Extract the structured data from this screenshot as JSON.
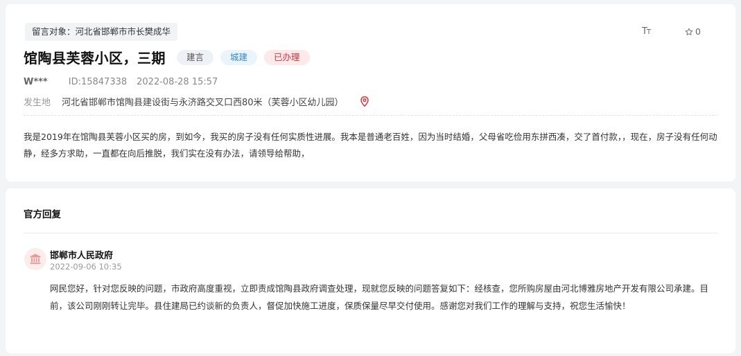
{
  "message": {
    "target_label": "留言对象：河北省邯郸市市长樊成华",
    "title": "馆陶县芙蓉小区，三期",
    "tags": {
      "type": "建言",
      "category": "城建",
      "status": "已办理"
    },
    "tools": {
      "font_size_icon_big": "T",
      "font_size_icon_small": "T",
      "favorite_count": "0"
    },
    "author": "W***",
    "id_text": "ID:15847338",
    "time": "2022-08-28 15:57",
    "location_label": "发生地",
    "location": "河北省邯郸市馆陶县建设街与永济路交叉口西80米（芙蓉小区幼儿园）",
    "content": "我是2019年在馆陶县芙蓉小区买的房，到如今，我买的房子没有任何实质性进展。我本是普通老百姓，因为当时结婚，父母省吃俭用东拼西凑，交了首付款，，现在，房子没有任何动静，经多方求助，一直都在向后推脱，我们实在没有办法，请领导给帮助，"
  },
  "reply": {
    "heading": "官方回复",
    "org_name": "邯郸市人民政府",
    "time": "2022-09-06 10:35",
    "content": "网民您好，针对您反映的问题，市政府高度重视，立即责成馆陶县政府调查处理，现就您反映的问题答复如下：经核查，您所购房屋由河北博雅房地产开发有限公司承建。目前，该公司刚刚转让完毕。县住建局已约谈新的负责人，督促加快施工进度，保质保量尽早交付使用。感谢您对我们工作的理解与支持，祝您生活愉快！"
  },
  "colors": {
    "accent_red": "#d8343f",
    "accent_blue": "#3a86c4",
    "background": "#f3f4f6"
  },
  "icons": {
    "font_size": "font-size-icon",
    "favorite": "star-icon",
    "location": "location-pin-icon",
    "org_avatar": "government-building-icon"
  }
}
